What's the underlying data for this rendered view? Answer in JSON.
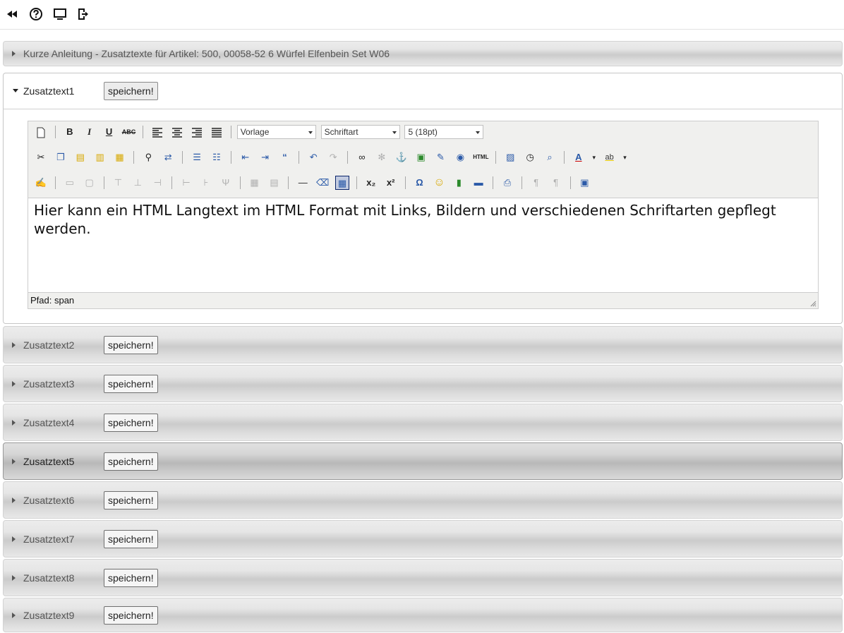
{
  "topbar": {
    "icons": [
      "rewind-icon",
      "help-icon",
      "monitor-icon",
      "exit-icon"
    ]
  },
  "info_panel": {
    "title": "Kurze Anleitung - Zusatztexte für Artikel: 500, 00058-52 6 Würfel Elfenbein Set W06"
  },
  "save_label": "speichern!",
  "sections": [
    {
      "label": "Zusatztext1",
      "expanded": true
    },
    {
      "label": "Zusatztext2"
    },
    {
      "label": "Zusatztext3"
    },
    {
      "label": "Zusatztext4"
    },
    {
      "label": "Zusatztext5",
      "hovered": true
    },
    {
      "label": "Zusatztext6"
    },
    {
      "label": "Zusatztext7"
    },
    {
      "label": "Zusatztext8"
    },
    {
      "label": "Zusatztext9"
    }
  ],
  "editor": {
    "format_select": "Vorlage",
    "font_select": "Schriftart",
    "size_select": "5 (18pt)",
    "content": "Hier kann ein HTML Langtext im HTML Format mit Links, Bildern und verschiedenen Schriftarten gepflegt werden.",
    "path_label": "Pfad: span",
    "toolbar_text": {
      "bold": "B",
      "italic": "I",
      "underline": "U",
      "strikethrough": "ABC",
      "html": "HTML",
      "font_color": "A",
      "highlight": "ab",
      "omega": "Ω"
    }
  },
  "colors": {
    "header_gradient_mid": "#cbcbcb",
    "toolbar_bg": "#f0f0ee",
    "editor_border": "#cccccc"
  }
}
